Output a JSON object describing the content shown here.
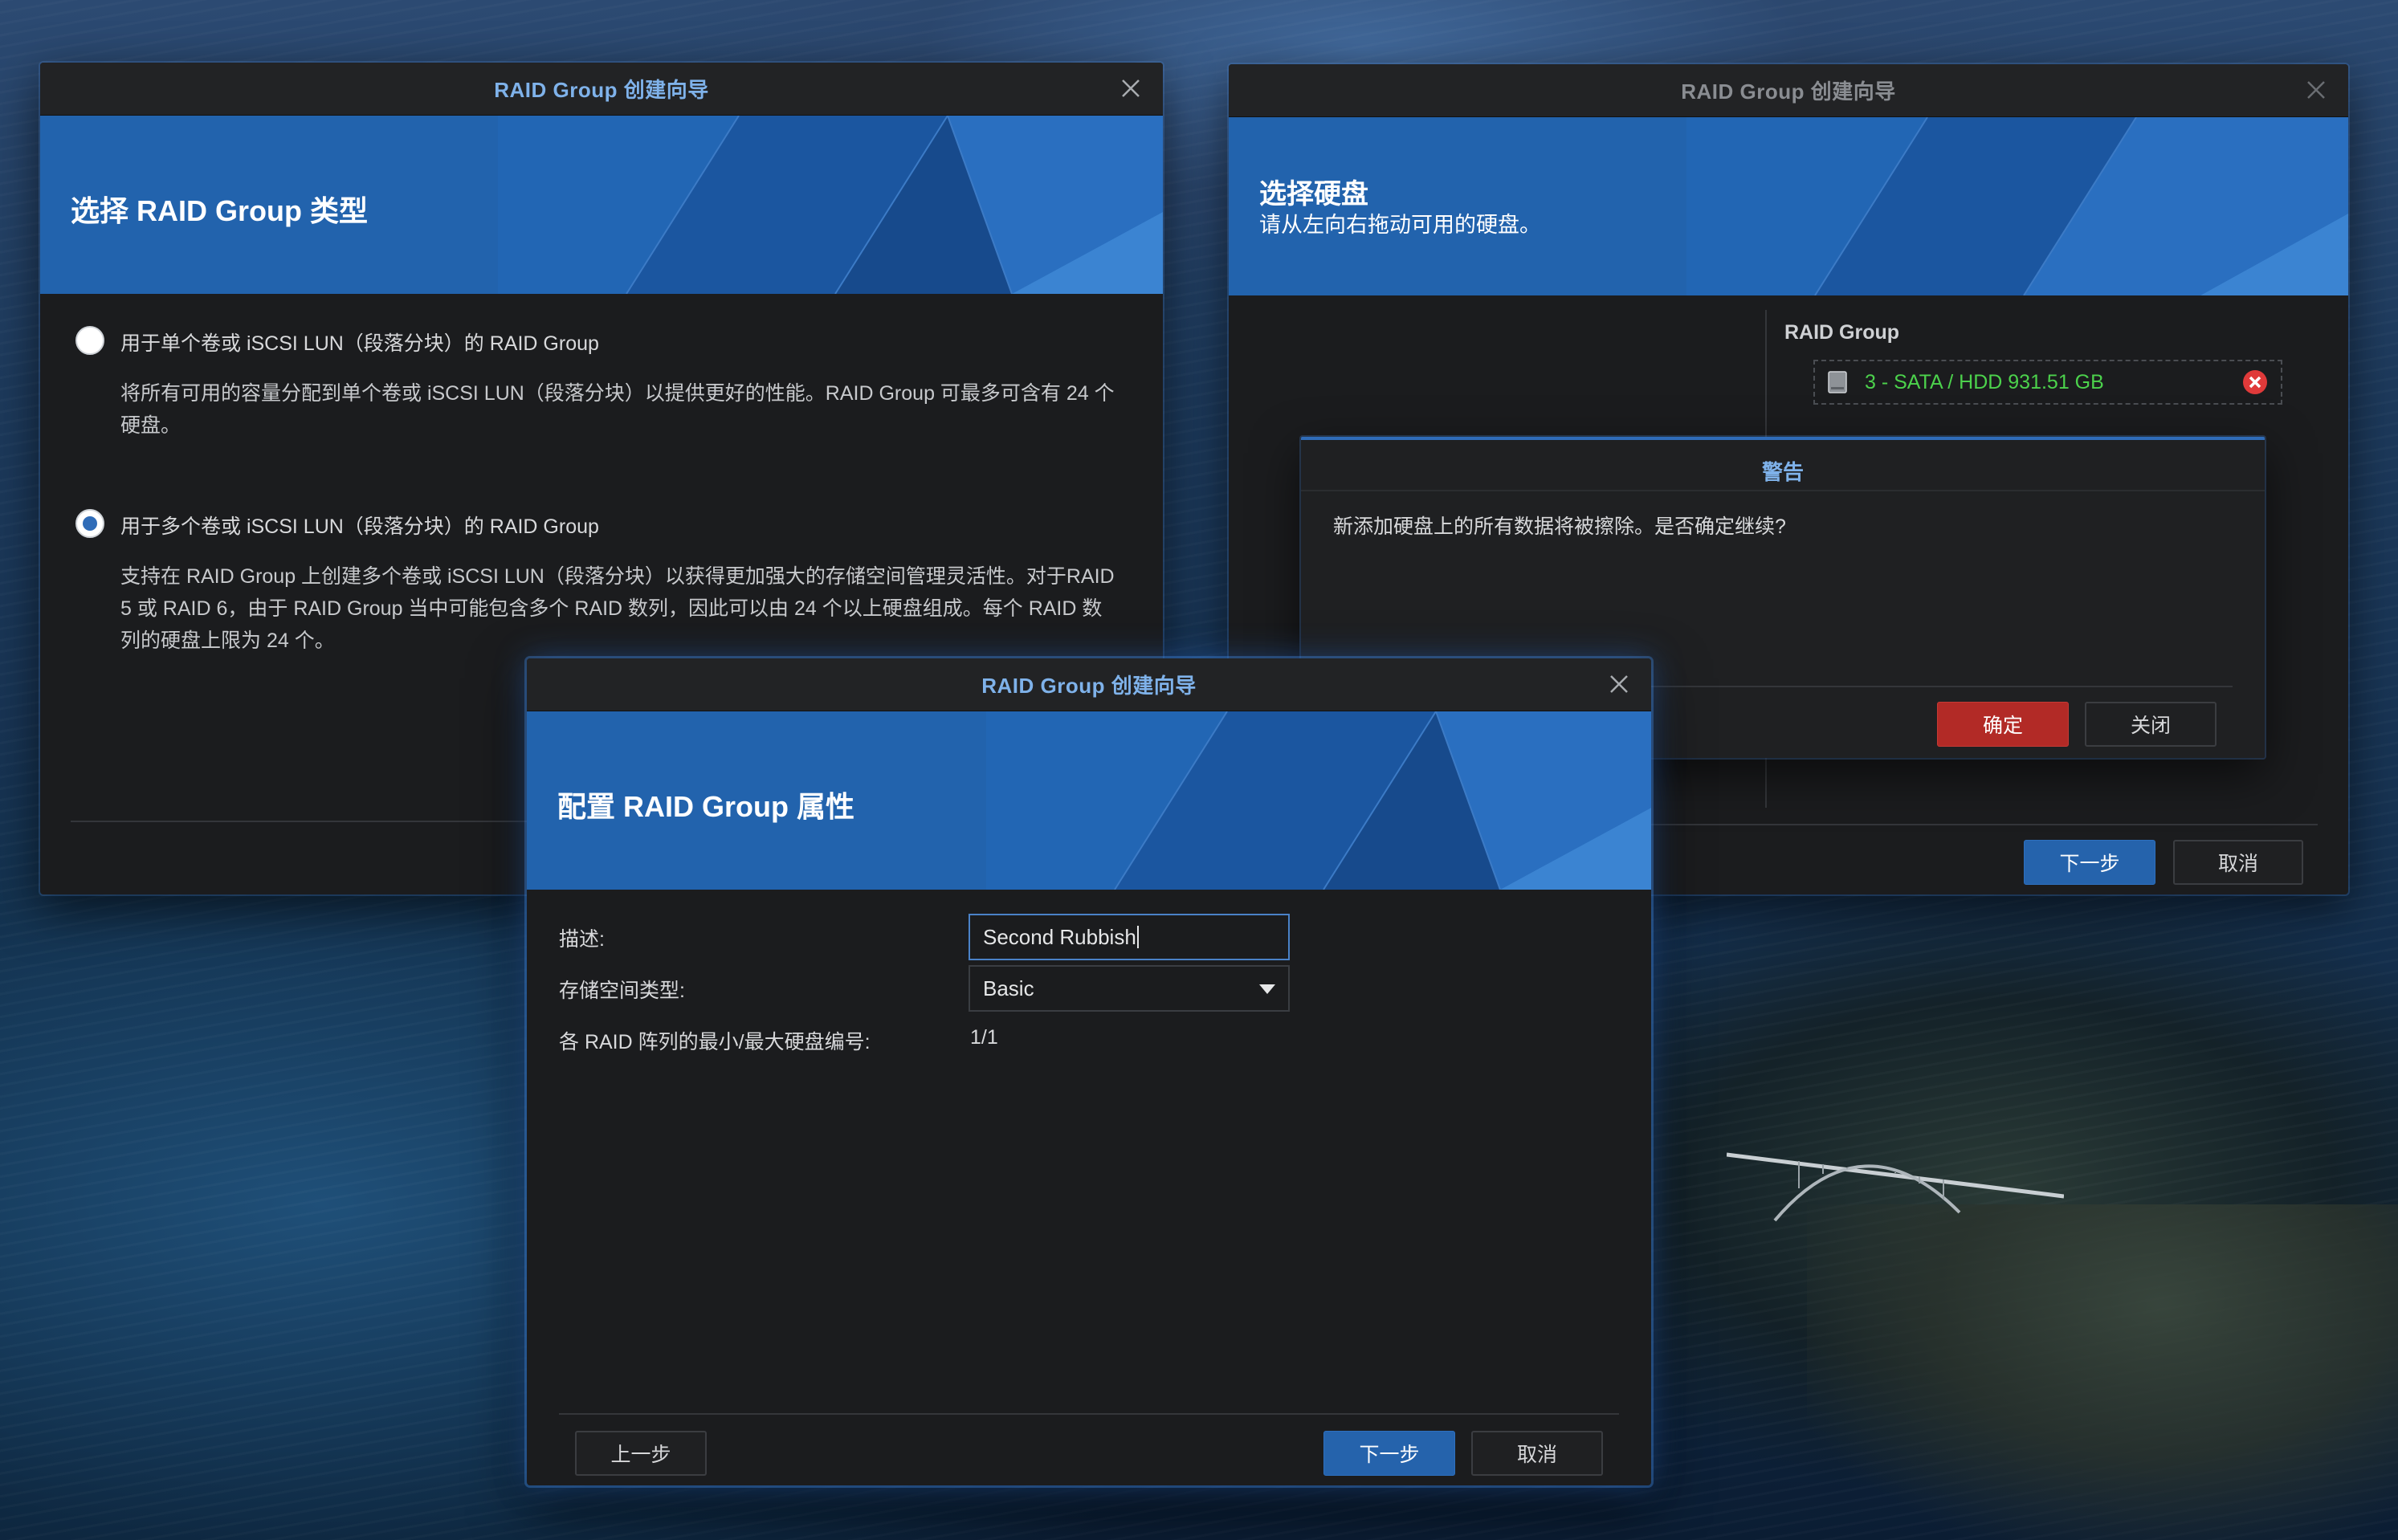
{
  "wizard_left": {
    "title": "RAID Group 创建向导",
    "heading": "选择 RAID Group 类型",
    "options": [
      {
        "label": "用于单个卷或 iSCSI LUN（段落分块）的 RAID Group",
        "description_line1": "将所有可用的容量分配到单个卷或 iSCSI LUN（段落分块）以提供更好的性能。RAID Group 可最多可含有 24 个",
        "description_line2": "硬盘。",
        "selected": false
      },
      {
        "label": "用于多个卷或 iSCSI LUN（段落分块）的 RAID Group",
        "description_line1": "支持在 RAID Group 上创建多个卷或 iSCSI LUN（段落分块）以获得更加强大的存储空间管理灵活性。对于RAID",
        "description_line2": "5 或 RAID 6，由于 RAID Group 当中可能包含多个 RAID 数列，因此可以由 24 个以上硬盘组成。每个 RAID 数",
        "description_line3": "列的硬盘上限为 24 个。",
        "selected": true
      }
    ]
  },
  "wizard_right": {
    "title": "RAID Group 创建向导",
    "heading": "选择硬盘",
    "subheading": "请从左向右拖动可用的硬盘。",
    "raid_group_label": "RAID Group",
    "disk_entry": "3 - SATA / HDD 931.51 GB",
    "next_button": "下一步",
    "cancel_button": "取消"
  },
  "warning_dialog": {
    "title": "警告",
    "message": "新添加硬盘上的所有数据将被擦除。是否确定继续?",
    "confirm_button": "确定",
    "close_button": "关闭"
  },
  "wizard_front": {
    "title": "RAID Group 创建向导",
    "heading": "配置 RAID Group 属性",
    "fields": {
      "description_label": "描述:",
      "description_value": "Second Rubbish",
      "storage_type_label": "存储空间类型:",
      "storage_type_value": "Basic",
      "min_max_label": "各 RAID 阵列的最小/最大硬盘编号:",
      "min_max_value": "1/1"
    },
    "back_button": "上一步",
    "next_button": "下一步",
    "cancel_button": "取消"
  },
  "colors": {
    "accent_blue": "#2563ac",
    "title_blue": "#7fb2ea",
    "danger_red": "#b22a26",
    "disk_green": "#4cd24c",
    "window_bg": "#1b1c1e"
  }
}
